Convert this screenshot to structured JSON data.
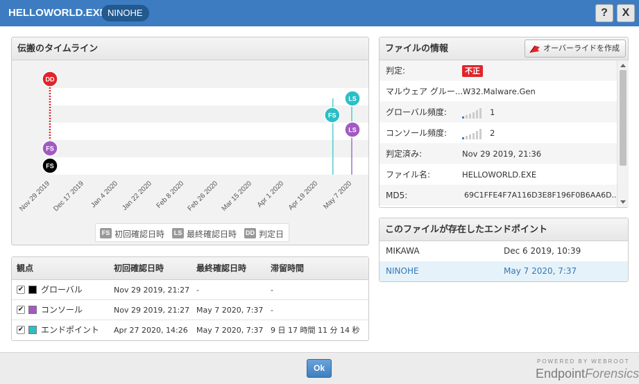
{
  "window": {
    "title": "HELLOWORLD.EXE",
    "host": "NINOHE",
    "help_label": "?",
    "close_label": "X"
  },
  "timeline": {
    "title": "伝搬のタイムライン",
    "x_ticks": [
      "Nov 29 2019",
      "Dec 17 2019",
      "Jan 4 2020",
      "Jan 22 2020",
      "Feb 8 2020",
      "Feb 26 2020",
      "Mar 15 2020",
      "Apr 1 2020",
      "Apr 19 2020",
      "May 7 2020"
    ],
    "rows": [
      {
        "perspective": "endpoint",
        "color": "#2bbfc6",
        "first_seen": "Apr 27 2020",
        "last_seen": "May 7 2020"
      },
      {
        "perspective": "console",
        "color": "#a259c4",
        "first_seen": "Nov 29 2019",
        "last_seen": "May 7 2020"
      },
      {
        "perspective": "global",
        "color": "#000000",
        "first_seen": "Nov 29 2019",
        "last_seen": ""
      }
    ],
    "determination": {
      "date": "Nov 29 2019",
      "color": "#e0242b"
    },
    "markers": {
      "fs": "FS",
      "ls": "LS",
      "dd": "DD"
    },
    "legend": {
      "fs_badge": "FS",
      "fs_label": "初回確認日時",
      "ls_badge": "LS",
      "ls_label": "最終確認日時",
      "dd_badge": "DD",
      "dd_label": "判定日"
    }
  },
  "perspectives": {
    "headers": {
      "view": "観点",
      "first": "初回確認日時",
      "last": "最終確認日時",
      "dwell": "滞留時間"
    },
    "rows": [
      {
        "label": "グローバル",
        "color": "#000000",
        "checked": "✔",
        "first": "Nov 29 2019, 21:27",
        "last": "-",
        "dwell": "-"
      },
      {
        "label": "コンソール",
        "color": "#a259c4",
        "checked": "✔",
        "first": "Nov 29 2019, 21:27",
        "last": "May 7 2020, 7:37",
        "dwell": "-"
      },
      {
        "label": "エンドポイント",
        "color": "#2bbfc6",
        "checked": "✔",
        "first": "Apr 27 2020, 14:26",
        "last": "May 7 2020, 7:37",
        "dwell": "9 日 17 時間 11 分 14 秒"
      }
    ]
  },
  "file_info": {
    "title": "ファイルの情報",
    "override_label": "オーバーライドを作成",
    "rows": [
      {
        "label": "判定:",
        "value": "不正"
      },
      {
        "label": "マルウェア グルー...",
        "value": "W32.Malware.Gen"
      },
      {
        "label": "グローバル頻度:",
        "value": "1"
      },
      {
        "label": "コンソール頻度:",
        "value": "2"
      },
      {
        "label": "判定済み:",
        "value": "Nov 29 2019, 21:36"
      },
      {
        "label": "ファイル名:",
        "value": "HELLOWORLD.EXE"
      },
      {
        "label": "MD5:",
        "value": "69C1FFE4F7A116D3E8F196F0B6AA6D..."
      }
    ],
    "bad_color": "#e0242b"
  },
  "endpoints": {
    "title": "このファイルが存在したエンドポイント",
    "rows": [
      {
        "name": "MIKAWA",
        "date": "Dec 6 2019, 10:39"
      },
      {
        "name": "NINOHE",
        "date": "May 7 2020, 7:37"
      }
    ]
  },
  "footer": {
    "ok_label": "Ok",
    "brand_top": "POWERED BY WEBROOT",
    "brand_a": "Endpoint",
    "brand_b": "Forensics"
  }
}
